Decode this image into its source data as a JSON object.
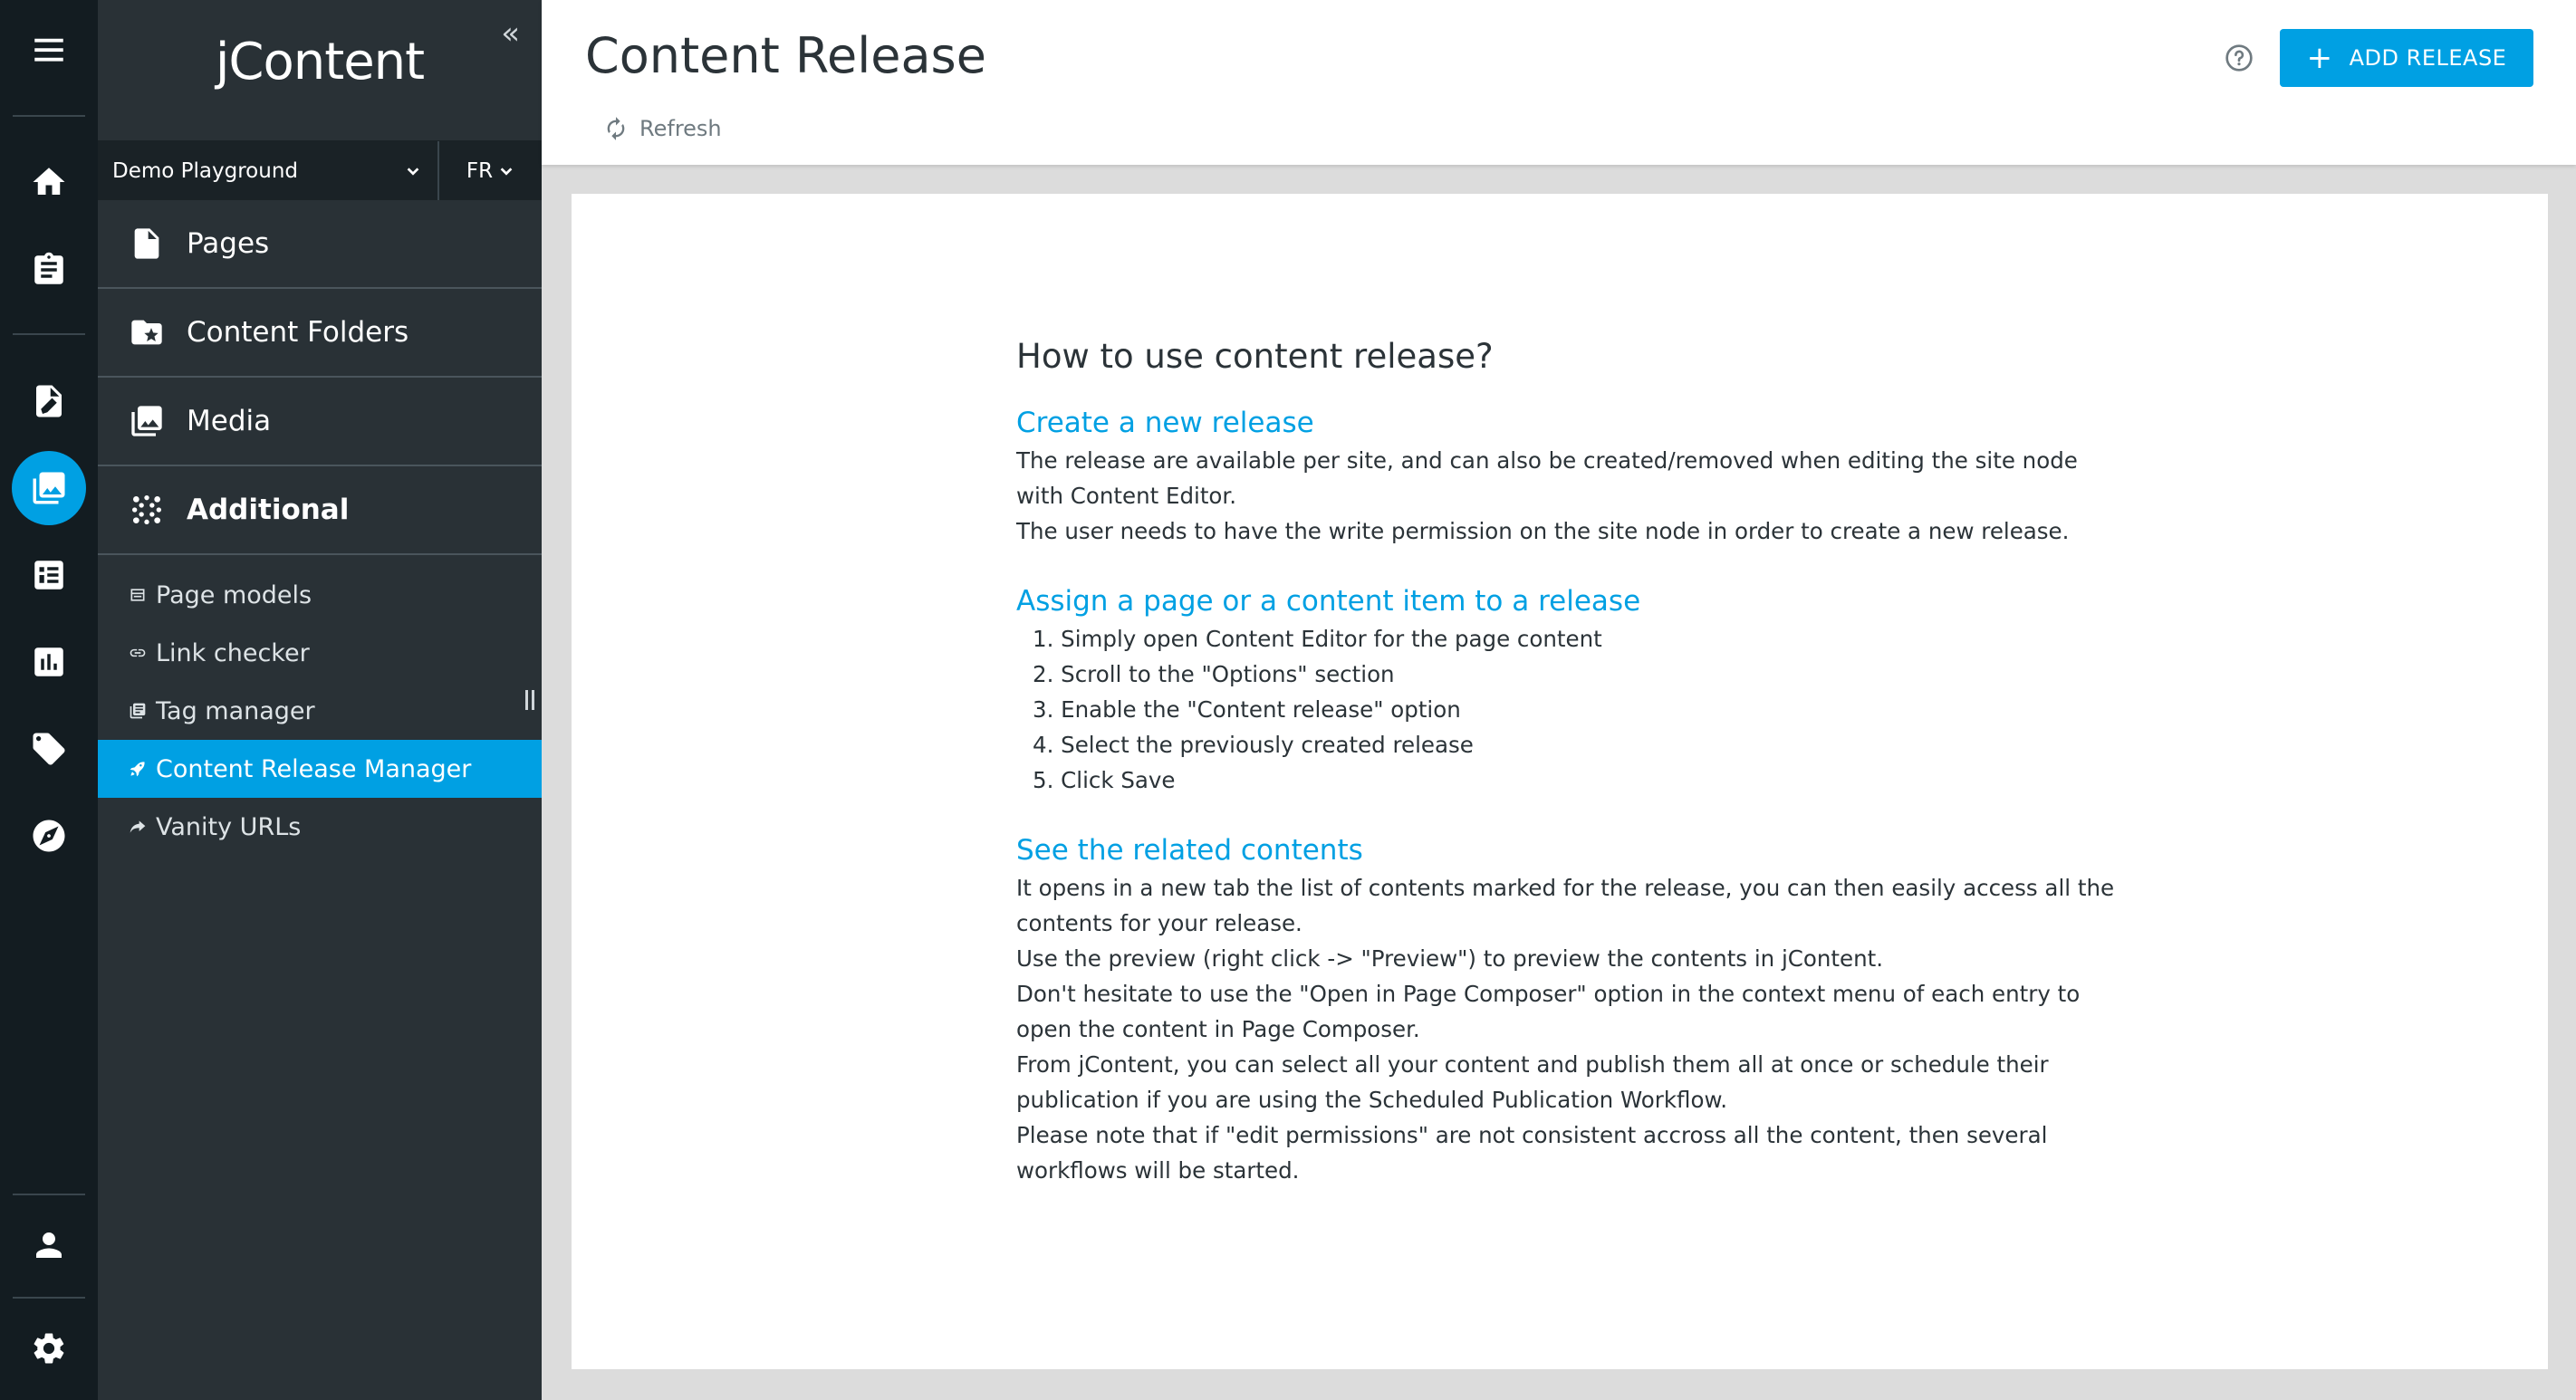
{
  "app": {
    "logo": "jContent"
  },
  "sidebar": {
    "site": "Demo Playground",
    "language": "FR",
    "main_items": [
      {
        "label": "Pages",
        "icon": "page-icon"
      },
      {
        "label": "Content Folders",
        "icon": "folder-star-icon"
      },
      {
        "label": "Media",
        "icon": "media-icon"
      },
      {
        "label": "Additional",
        "icon": "grid-dots-icon"
      }
    ],
    "sub_items": [
      {
        "label": "Page models",
        "icon": "page-model-icon"
      },
      {
        "label": "Link checker",
        "icon": "link-icon"
      },
      {
        "label": "Tag manager",
        "icon": "tag-manager-icon"
      },
      {
        "label": "Content Release Manager",
        "icon": "rocket-icon",
        "active": true
      },
      {
        "label": "Vanity URLs",
        "icon": "arrow-forward-icon"
      }
    ]
  },
  "header": {
    "title": "Content Release",
    "refresh_label": "Refresh",
    "add_button_label": "ADD RELEASE"
  },
  "help": {
    "heading": "How to use content release?",
    "create": {
      "title": "Create a new release",
      "lines": [
        "The release are available per site, and can also be created/removed when editing the site node with Content Editor.",
        "The user needs to have the write permission on the site node in order to create a new release."
      ]
    },
    "assign": {
      "title": "Assign a page or a content item to a release",
      "steps": [
        "1. Simply open Content Editor for the page content",
        "2. Scroll to the \"Options\" section",
        "3. Enable the \"Content release\" option",
        "4. Select the previously created release",
        "5. Click Save"
      ]
    },
    "related": {
      "title": "See the related contents",
      "lines": [
        "It opens in a new tab the list of contents marked for the release, you can then easily access all the contents for your release.",
        "Use the preview (right click -> \"Preview\") to preview the contents in jContent.",
        "Don't hesitate to use the \"Open in Page Composer\" option in the context menu of each entry to open the content in Page Composer.",
        "From jContent, you can select all your content and publish them all at once or schedule their publication if you are using the Scheduled Publication Workflow.",
        "Please note that if \"edit permissions\" are not consistent accross all the content, then several workflows will be started."
      ]
    }
  },
  "colors": {
    "accent": "#00a0e3",
    "rail": "#131c21",
    "sidebar": "#293136"
  }
}
